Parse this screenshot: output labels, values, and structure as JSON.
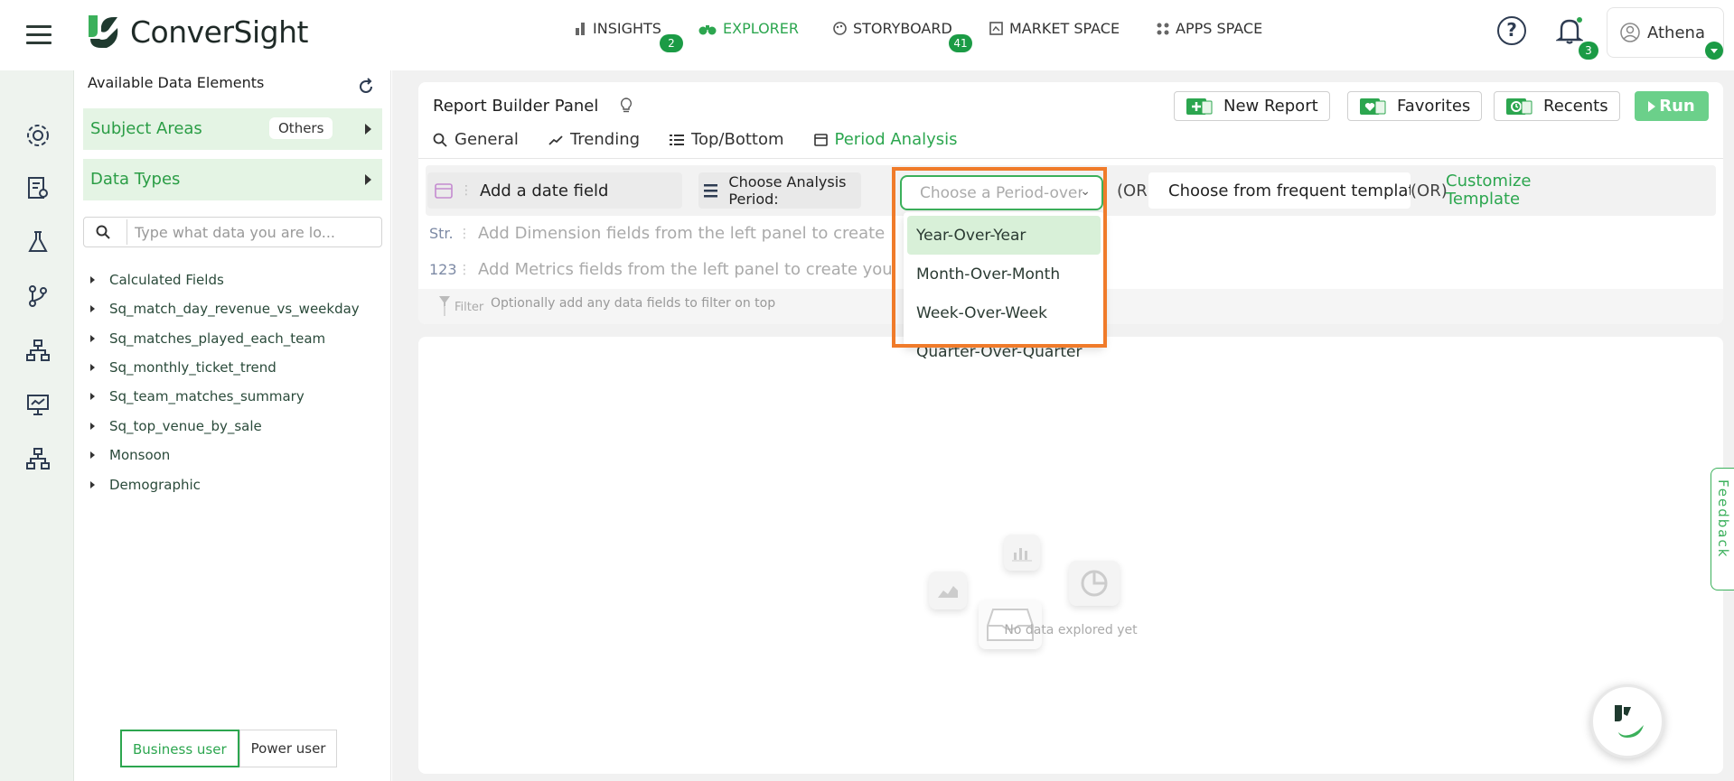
{
  "brand": {
    "name": "ConverSight",
    "accent": "#2ca64f",
    "highlight": "#f07b2a"
  },
  "nav": {
    "items": [
      {
        "label": "INSIGHTS",
        "badge": "2",
        "icon": "bar-chart-icon"
      },
      {
        "label": "EXPLORER",
        "badge": "",
        "icon": "binoculars-icon",
        "active": true
      },
      {
        "label": "STORYBOARD",
        "badge": "41",
        "icon": "palette-icon"
      },
      {
        "label": "MARKET SPACE",
        "badge": "",
        "icon": "market-icon"
      },
      {
        "label": "APPS SPACE",
        "badge": "",
        "icon": "grid-icon"
      }
    ],
    "notifications_badge": "3",
    "user_name": "Athena"
  },
  "data_panel": {
    "title": "Available Data Elements",
    "subject_areas_label": "Subject Areas",
    "subject_areas_value": "Others",
    "data_types_label": "Data Types",
    "search_placeholder": "Type what data you are lo...",
    "tree": [
      "Calculated Fields",
      "Sq_match_day_revenue_vs_weekday",
      "Sq_matches_played_each_team",
      "Sq_monthly_ticket_trend",
      "Sq_team_matches_summary",
      "Sq_top_venue_by_sale",
      "Monsoon",
      "Demographic"
    ],
    "mode_business": "Business user",
    "mode_power": "Power user"
  },
  "builder": {
    "title": "Report Builder Panel",
    "buttons": {
      "new_report": "New Report",
      "favorites": "Favorites",
      "recents": "Recents",
      "run": "Run"
    },
    "tabs": [
      "General",
      "Trending",
      "Top/Bottom",
      "Period Analysis"
    ],
    "date_field": "Add a date field",
    "analysis_period_label": "Choose Analysis Period:",
    "period_placeholder": "Choose a Period-over-Period",
    "or_label": "(OR)",
    "template_placeholder": "Choose from frequent templates",
    "customize": "Customize Template",
    "dimension_tag": "Str.",
    "dimension_hint": "Add Dimension fields from the left panel to create",
    "metric_tag": "123",
    "metric_hint": "Add Metrics fields from the left panel to create you",
    "filter_label": "Filter",
    "filter_hint": "Optionally add any data fields to filter on top"
  },
  "period_options": [
    "Year-Over-Year",
    "Month-Over-Month",
    "Week-Over-Week",
    "Quarter-Over-Quarter"
  ],
  "results": {
    "empty_text": "No data explored yet"
  },
  "feedback_label": "Feedback"
}
